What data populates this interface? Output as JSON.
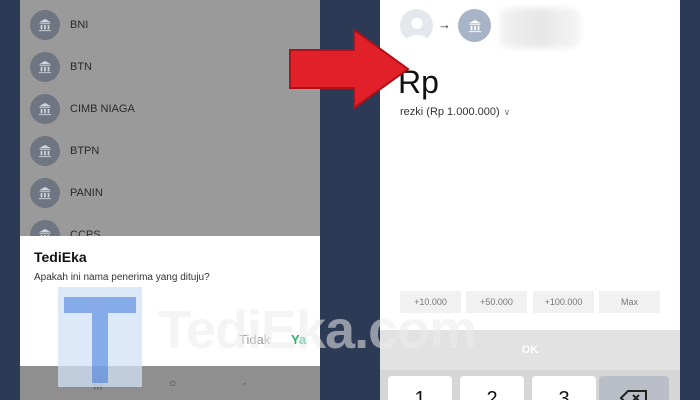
{
  "left_screen": {
    "banks": [
      "BNI",
      "BTN",
      "CIMB NIAGA",
      "BTPN",
      "PANIN",
      "CCPS"
    ],
    "dialog": {
      "title": "TediEka",
      "message": "Apakah ini nama penerima yang dituju?",
      "no_label": "Tidak",
      "yes_label": "Ya"
    },
    "nav": {
      "recents": "|||",
      "home": "○",
      "back": "·"
    }
  },
  "right_screen": {
    "currency": "Rp",
    "source_account": "rezki (Rp 1.000.000)",
    "arrow_glyph": "→",
    "quick_amounts": [
      "+10.000",
      "+50.000",
      "+100.000",
      "Max"
    ],
    "ok_label": "OK",
    "keys": [
      "1",
      "2",
      "3"
    ]
  },
  "watermark": {
    "text": "TediEka.com",
    "letter": "T"
  },
  "colors": {
    "arrow": "#e2202a",
    "dialog_yes": "#2db36a",
    "background": "#2c3a55"
  }
}
